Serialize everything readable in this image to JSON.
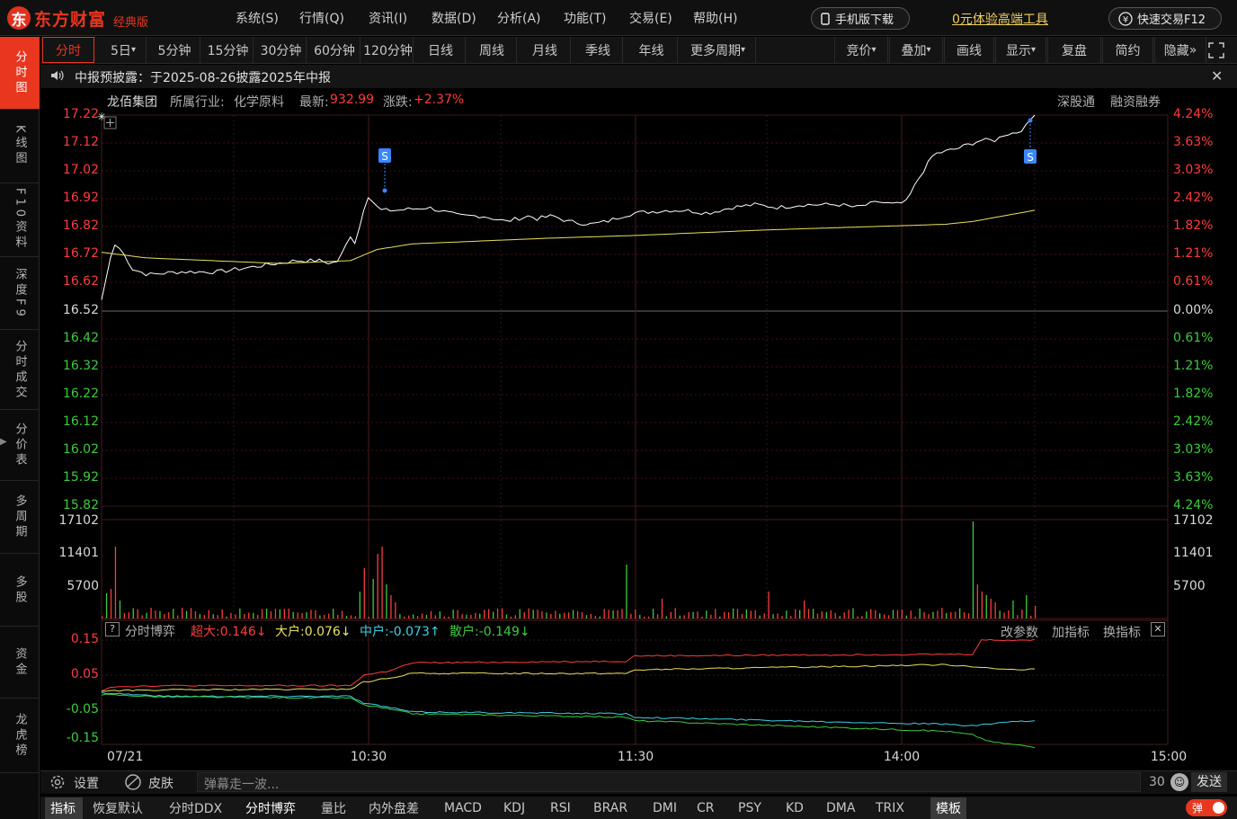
{
  "app": {
    "logo_text": "东方财富",
    "edition": "经典版"
  },
  "menu": [
    "系统(S)",
    "行情(Q)",
    "资讯(I)",
    "数据(D)",
    "分析(A)",
    "功能(T)",
    "交易(E)",
    "帮助(H)"
  ],
  "top_right": {
    "mobile": "手机版下载",
    "trial": "0元体验高端工具",
    "quick_trade": "快速交易F12"
  },
  "sidebar": [
    "分时图",
    "K线图",
    "F10资料",
    "深度F9",
    "分时成交",
    "分价表",
    "多周期",
    "多股",
    "资金",
    "龙虎榜"
  ],
  "periods": [
    "分时",
    "5日",
    "5分钟",
    "15分钟",
    "30分钟",
    "60分钟",
    "120分钟",
    "日线",
    "周线",
    "月线",
    "季线",
    "年线",
    "更多周期"
  ],
  "period_tools": [
    "竞价",
    "叠加",
    "画线",
    "显示",
    "复盘",
    "简约",
    "隐藏"
  ],
  "notice": "中报预披露：于2025-08-26披露2025年中报",
  "info": {
    "name": "龙佰集团",
    "industry_label": "所属行业:",
    "industry": "化学原料",
    "latest_label": "最新:",
    "latest": "932.99",
    "change_label": "涨跌:",
    "change": "+2.37%",
    "right_links": [
      "深股通",
      "融资融券"
    ]
  },
  "price_axis": {
    "left": [
      "17.22",
      "17.12",
      "17.02",
      "16.92",
      "16.82",
      "16.72",
      "16.62",
      "16.52",
      "16.42",
      "16.32",
      "16.22",
      "16.12",
      "16.02",
      "15.92",
      "15.82"
    ],
    "right": [
      "4.24%",
      "3.63%",
      "3.03%",
      "2.42%",
      "1.82%",
      "1.21%",
      "0.61%",
      "0.00%",
      "0.61%",
      "1.21%",
      "1.82%",
      "2.42%",
      "3.03%",
      "3.63%",
      "4.24%"
    ]
  },
  "volume_axis": [
    "17102",
    "11401",
    "5700"
  ],
  "flow_panel": {
    "title": "分时博弈",
    "super_label": "超大:0.146↓",
    "large_label": "大户:0.076↓",
    "mid_label": "中户:-0.073↑",
    "retail_label": "散户:-0.149↓",
    "actions": [
      "改参数",
      "加指标",
      "换指标"
    ],
    "axis": [
      "0.15",
      "0.05",
      "-0.05",
      "-0.15"
    ]
  },
  "time_axis": [
    "07/21",
    "10:30",
    "11:30",
    "14:00",
    "15:00"
  ],
  "markers": [
    "S",
    "S"
  ],
  "bottom": {
    "settings": "设置",
    "skin": "皮肤",
    "danmaku_placeholder": "弹幕走一波...",
    "count": "30",
    "send": "发送"
  },
  "tabs": [
    "指标",
    "恢复默认",
    "分时DDX",
    "分时博弈",
    "量比",
    "内外盘差",
    "MACD",
    "KDJ",
    "RSI",
    "BRAR",
    "DMI",
    "CR",
    "PSY",
    "KD",
    "DMA",
    "TRIX",
    "模板"
  ],
  "toggle_label": "弹",
  "colors": {
    "up": "#ff3b3b",
    "down": "#3ccc3c",
    "price_line": "#ffffff",
    "avg_line": "#e8e060",
    "accent": "#e8361f",
    "cyan": "#3cd0e6"
  }
}
